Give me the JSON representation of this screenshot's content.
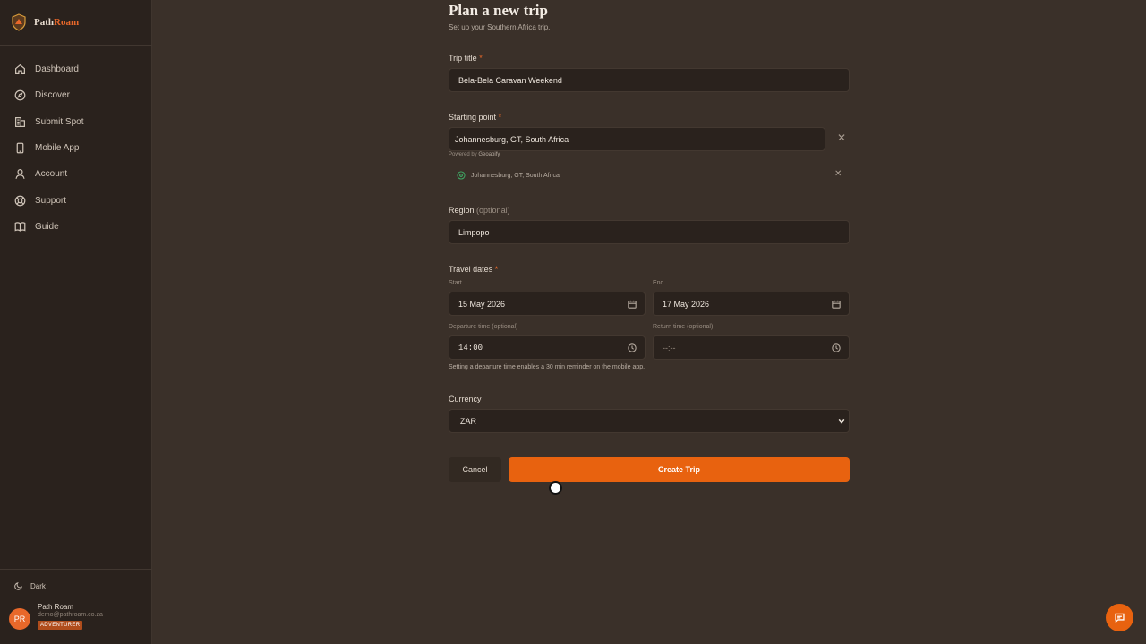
{
  "brand": {
    "name_part1": "Path",
    "name_part2": "Roam"
  },
  "sidebar": {
    "items": [
      {
        "label": "Dashboard",
        "icon": "home-icon"
      },
      {
        "label": "Discover",
        "icon": "compass-icon"
      },
      {
        "label": "Submit Spot",
        "icon": "building-icon"
      },
      {
        "label": "Mobile App",
        "icon": "phone-icon"
      },
      {
        "label": "Account",
        "icon": "user-icon"
      },
      {
        "label": "Support",
        "icon": "lifebuoy-icon"
      },
      {
        "label": "Guide",
        "icon": "book-icon"
      }
    ],
    "theme_label": "Dark",
    "user": {
      "initials": "PR",
      "name": "Path Roam",
      "email": "demo@pathroam.co.za",
      "badge": "ADVENTURER"
    }
  },
  "page": {
    "title": "Plan a new trip",
    "subtitle": "Set up your Southern Africa trip."
  },
  "form": {
    "trip_title": {
      "label": "Trip title",
      "required": "*",
      "value": "Bela-Bela Caravan Weekend"
    },
    "starting_point": {
      "label": "Starting point",
      "required": "*",
      "value": "Johannesburg, GT, South Africa",
      "powered_prefix": "Powered by",
      "powered_link": "Geoapify",
      "suggestion": "Johannesburg, GT, South Africa"
    },
    "region": {
      "label": "Region",
      "optional": "(optional)",
      "value": "Limpopo"
    },
    "travel_dates": {
      "label": "Travel dates",
      "required": "*",
      "start_label": "Start",
      "start_value": "15 May 2026",
      "end_label": "End",
      "end_value": "17 May 2026",
      "departure_label": "Departure time (optional)",
      "departure_value": "14:00",
      "return_label": "Return time (optional)",
      "return_value": "--:--",
      "hint": "Setting a departure time enables a 30 min reminder on the mobile app."
    },
    "currency": {
      "label": "Currency",
      "value": "ZAR"
    },
    "cancel_label": "Cancel",
    "create_label": "Create Trip"
  },
  "colors": {
    "accent": "#e8620f",
    "background": "#3a3029",
    "sidebar": "#2a221d"
  }
}
